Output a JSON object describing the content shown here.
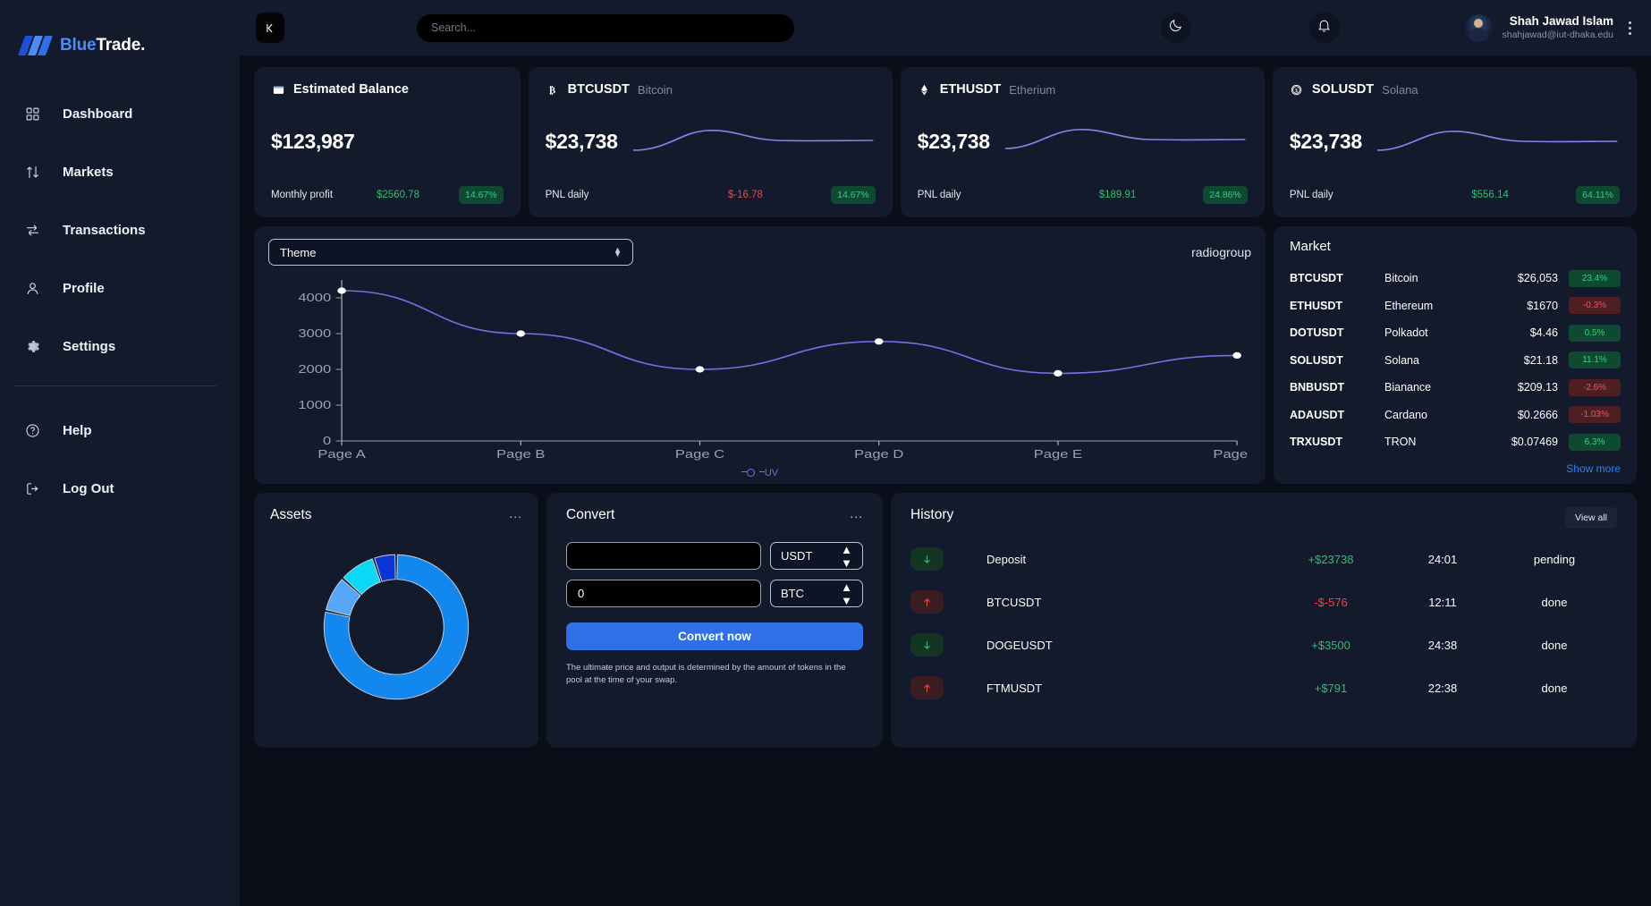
{
  "brand": {
    "first": "Blue",
    "second": "Trade."
  },
  "sidebar": {
    "items": [
      {
        "label": "Dashboard",
        "icon": "grid-icon"
      },
      {
        "label": "Markets",
        "icon": "arrows-updown-icon"
      },
      {
        "label": "Transactions",
        "icon": "transfer-icon"
      },
      {
        "label": "Profile",
        "icon": "user-icon"
      },
      {
        "label": "Settings",
        "icon": "gear-icon"
      }
    ],
    "bottom_items": [
      {
        "label": "Help",
        "icon": "question-circle-icon"
      },
      {
        "label": "Log Out",
        "icon": "logout-icon"
      }
    ]
  },
  "topbar": {
    "collapse_icon": "collapse-left-icon",
    "search_placeholder": "Search...",
    "search_value": "",
    "theme_icon": "moon-icon",
    "notification_icon": "bell-icon",
    "user_name": "Shah Jawad Islam",
    "user_email": "shahjawad@iut-dhaka.edu",
    "menu_icon": "kebab-menu-icon"
  },
  "cards": {
    "balance": {
      "icon": "wallet-icon",
      "title": "Estimated Balance",
      "amount": "$123,987",
      "label": "Monthly profit",
      "value": "$2560.78",
      "badge": "14.67%",
      "badge_dir": "up",
      "value_dir": "pos"
    },
    "coins": [
      {
        "icon": "bitcoin-icon",
        "symbol": "BTCUSDT",
        "name": "Bitcoin",
        "amount": "$23,738",
        "label": "PNL daily",
        "value": "$-16.78",
        "value_dir": "neg",
        "badge": "14.67%",
        "badge_dir": "up"
      },
      {
        "icon": "ethereum-icon",
        "symbol": "ETHUSDT",
        "name": "Etherium",
        "amount": "$23,738",
        "label": "PNL daily",
        "value": "$189.91",
        "value_dir": "pos",
        "badge": "24.86%",
        "badge_dir": "up"
      },
      {
        "icon": "solana-icon",
        "symbol": "SOLUSDT",
        "name": "Solana",
        "amount": "$23,738",
        "label": "PNL daily",
        "value": "$556.14",
        "value_dir": "pos",
        "badge": "64.11%",
        "badge_dir": "up"
      }
    ]
  },
  "chart_panel": {
    "theme_select_label": "Theme",
    "radiogroup_label": "radiogroup"
  },
  "chart_data": {
    "type": "line",
    "title": "",
    "xlabel": "",
    "ylabel": "",
    "categories": [
      "Page A",
      "Page B",
      "Page C",
      "Page D",
      "Page E",
      "Page F"
    ],
    "series": [
      {
        "name": "UV",
        "values": [
          4200,
          3000,
          2000,
          2780,
          1890,
          2390
        ],
        "color": "#7b6ce0"
      }
    ],
    "yticks": [
      0,
      1000,
      2000,
      3000,
      4000
    ],
    "ylim": [
      0,
      4500
    ],
    "legend": [
      "UV"
    ],
    "legend_position": "bottom",
    "grid": false
  },
  "market": {
    "title": "Market",
    "show_more": "Show more",
    "rows": [
      {
        "symbol": "BTCUSDT",
        "name": "Bitcoin",
        "price": "$26,053",
        "change": "23.4%",
        "dir": "up"
      },
      {
        "symbol": "ETHUSDT",
        "name": "Ethereum",
        "price": "$1670",
        "change": "-0.3%",
        "dir": "down"
      },
      {
        "symbol": "DOTUSDT",
        "name": "Polkadot",
        "price": "$4.46",
        "change": "0.5%",
        "dir": "up"
      },
      {
        "symbol": "SOLUSDT",
        "name": "Solana",
        "price": "$21.18",
        "change": "11.1%",
        "dir": "up"
      },
      {
        "symbol": "BNBUSDT",
        "name": "Bianance",
        "price": "$209.13",
        "change": "-2.6%",
        "dir": "down"
      },
      {
        "symbol": "ADAUSDT",
        "name": "Cardano",
        "price": "$0.2666",
        "change": "-1.03%",
        "dir": "down"
      },
      {
        "symbol": "TRXUSDT",
        "name": "TRON",
        "price": "$0.07469",
        "change": "6.3%",
        "dir": "up"
      }
    ]
  },
  "assets": {
    "title": "Assets",
    "menu": "...",
    "donut": {
      "type": "pie",
      "values": [
        77,
        8,
        8,
        5
      ],
      "colors": [
        "#1287f0",
        "#55a8f7",
        "#0ad9f5",
        "#0b35d6"
      ]
    }
  },
  "convert": {
    "title": "Convert",
    "menu": "...",
    "from_value": "",
    "from_placeholder": "",
    "from_currency": "USDT",
    "to_value": "0",
    "to_currency": "BTC",
    "button": "Convert now",
    "note": "The ultimate price and output is determined by the amount of tokens in the pool at the time of your swap."
  },
  "history": {
    "title": "History",
    "view_all": "View all",
    "rows": [
      {
        "dir": "in",
        "name": "Deposit",
        "amount": "+$23738",
        "amount_dir": "pos",
        "time": "24:01",
        "status": "pending"
      },
      {
        "dir": "out",
        "name": "BTCUSDT",
        "amount": "-$-576",
        "amount_dir": "neg",
        "time": "12:11",
        "status": "done"
      },
      {
        "dir": "in",
        "name": "DOGEUSDT",
        "amount": "+$3500",
        "amount_dir": "pos",
        "time": "24:38",
        "status": "done"
      },
      {
        "dir": "out",
        "name": "FTMUSDT",
        "amount": "+$791",
        "amount_dir": "pos",
        "time": "22:38",
        "status": "done"
      }
    ]
  }
}
